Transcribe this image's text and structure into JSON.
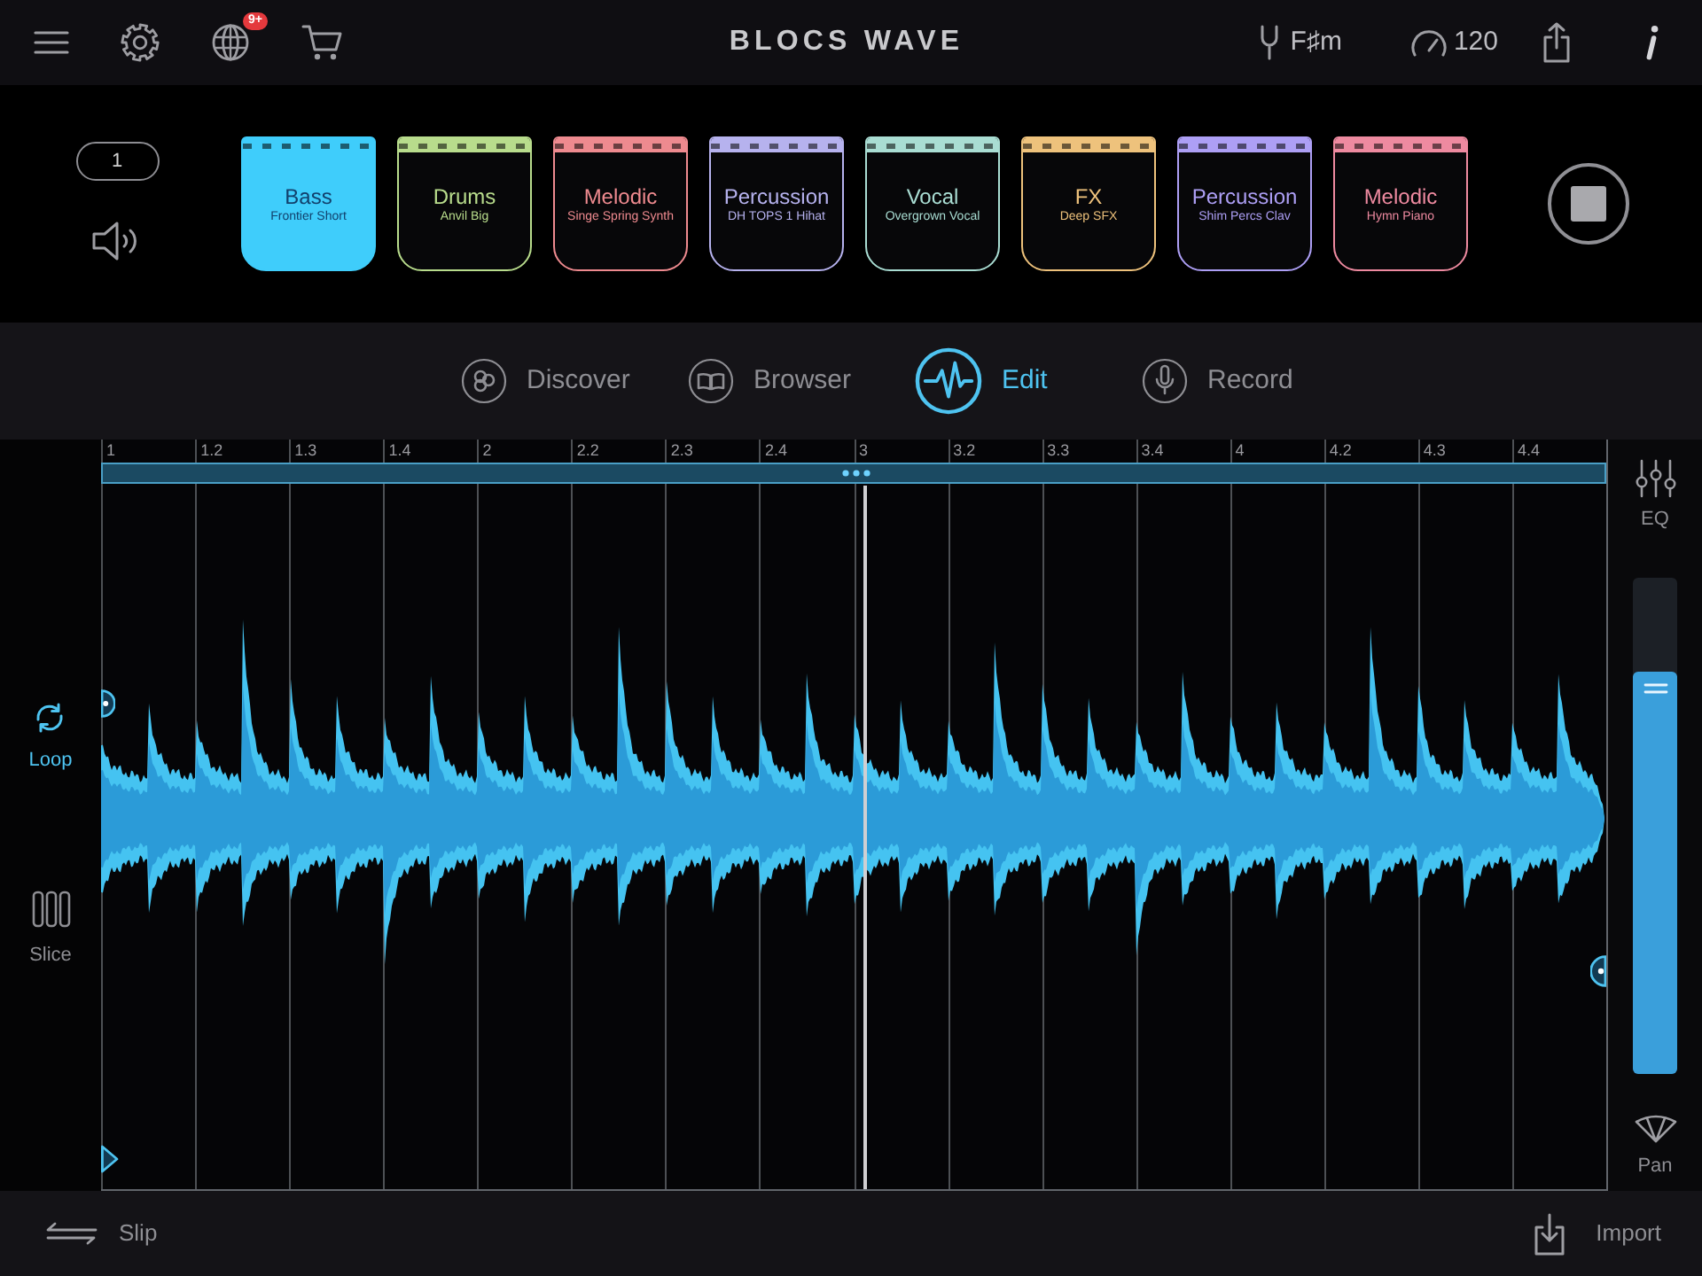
{
  "top_bar": {
    "title": "BLOCS WAVE",
    "notification_badge": "9+",
    "key": "F♯m",
    "tempo": "120"
  },
  "bloc_panel": {
    "group_number": "1",
    "blocs": [
      {
        "category": "Bass",
        "name": "Frontier Short",
        "color": "#3fcdfb",
        "selected": true
      },
      {
        "category": "Drums",
        "name": "Anvil Big",
        "color": "#b8dc8c",
        "selected": false
      },
      {
        "category": "Melodic",
        "name": "Singe Spring Synth",
        "color": "#ee8a8f",
        "selected": false
      },
      {
        "category": "Percussion",
        "name": "DH TOPS 1 Hihat",
        "color": "#b6b2ee",
        "selected": false
      },
      {
        "category": "Vocal",
        "name": "Overgrown Vocal",
        "color": "#a9ddd3",
        "selected": false
      },
      {
        "category": "FX",
        "name": "Deep SFX",
        "color": "#eec27c",
        "selected": false
      },
      {
        "category": "Percussion",
        "name": "Shim Percs Clav",
        "color": "#ad9ff5",
        "selected": false
      },
      {
        "category": "Melodic",
        "name": "Hymn Piano",
        "color": "#ee8aa0",
        "selected": false
      }
    ]
  },
  "tabs": [
    {
      "label": "Discover",
      "selected": false
    },
    {
      "label": "Browser",
      "selected": false
    },
    {
      "label": "Edit",
      "selected": true
    },
    {
      "label": "Record",
      "selected": false
    }
  ],
  "editor": {
    "ruler": [
      "1",
      "1.2",
      "1.3",
      "1.4",
      "2",
      "2.2",
      "2.3",
      "2.4",
      "3",
      "3.2",
      "3.3",
      "3.4",
      "4",
      "4.2",
      "4.3",
      "4.4"
    ],
    "tools": [
      {
        "label": "Loop",
        "selected": true
      },
      {
        "label": "Slice",
        "selected": false
      }
    ],
    "eq_label": "EQ",
    "volume": {
      "level": 0.81
    },
    "pan_label": "Pan"
  },
  "bottom_bar": {
    "slip_label": "Slip",
    "import_label": "Import"
  }
}
